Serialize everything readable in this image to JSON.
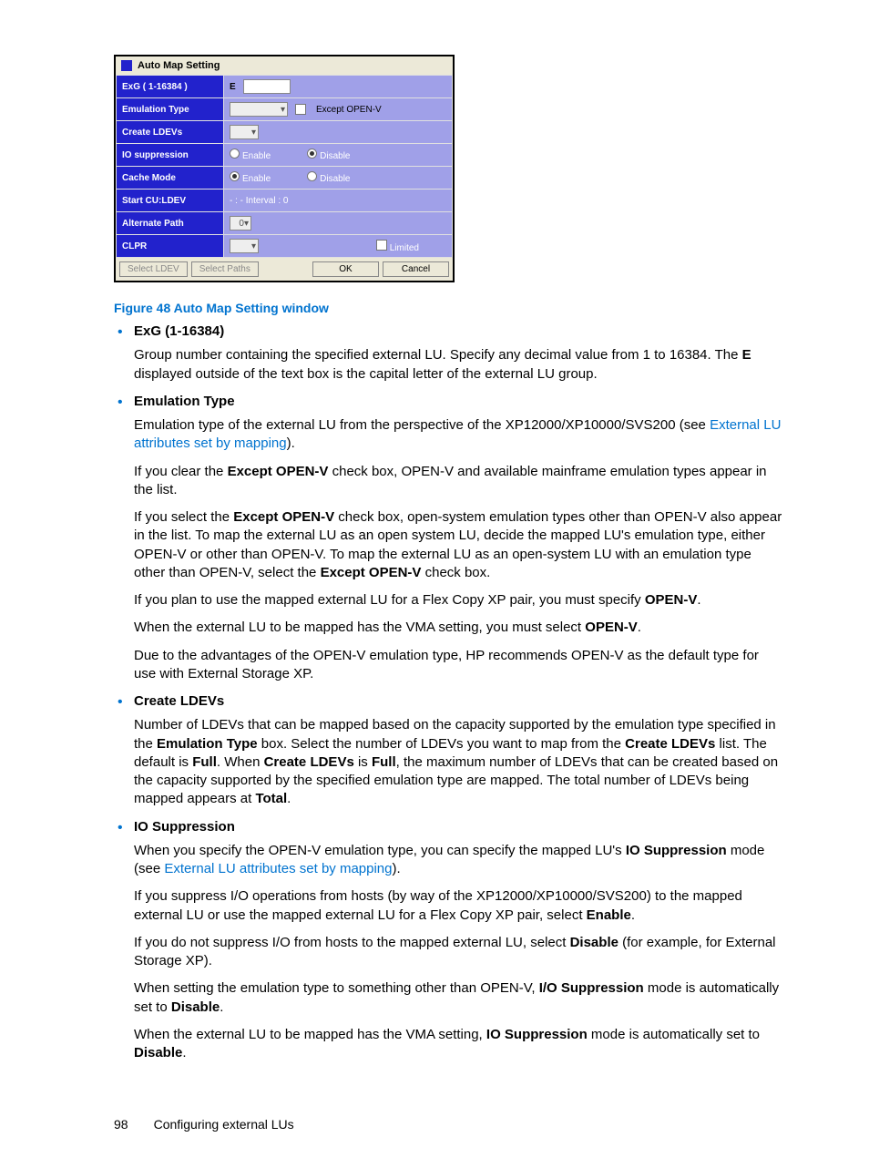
{
  "dialog": {
    "title": "Auto Map Setting",
    "rows": {
      "exg": {
        "label": "ExG ( 1-16384 )",
        "prefix": "E"
      },
      "emul": {
        "label": "Emulation Type",
        "checkbox": "Except OPEN-V"
      },
      "create": {
        "label": "Create LDEVs"
      },
      "io": {
        "label": "IO suppression",
        "opt1": "Enable",
        "opt2": "Disable"
      },
      "cache": {
        "label": "Cache Mode",
        "opt1": "Enable",
        "opt2": "Disable"
      },
      "start": {
        "label": "Start CU:LDEV",
        "text": "- : -     Interval : 0"
      },
      "alt": {
        "label": "Alternate Path",
        "val": "0"
      },
      "clpr": {
        "label": "CLPR",
        "checkbox": "Limited"
      }
    },
    "buttons": {
      "selLdev": "Select LDEV",
      "selPaths": "Select Paths",
      "ok": "OK",
      "cancel": "Cancel"
    }
  },
  "figure_caption": "Figure 48 Auto Map Setting window",
  "items": {
    "exg": {
      "term": "ExG (1-16384)",
      "p1a": "Group number containing the specified external LU. Specify any decimal value from 1 to 16384. The ",
      "p1b": "E",
      "p1c": " displayed outside of the text box is the capital letter of the external LU group."
    },
    "emul": {
      "term": "Emulation Type",
      "p1a": "Emulation type of the external LU from the perspective of the XP12000/XP10000/SVS200 (see ",
      "p1link": "External LU attributes set by mapping",
      "p1c": ").",
      "p2a": "If you clear the ",
      "p2b": "Except OPEN-V",
      "p2c": " check box, OPEN-V and available mainframe emulation types appear in the list.",
      "p3a": "If you select the ",
      "p3b": "Except OPEN-V",
      "p3c": " check box, open-system emulation types other than OPEN-V also appear in the list. To map the external LU as an open system LU, decide the mapped LU's emulation type, either OPEN-V or other than OPEN-V. To map the external LU as an open-system LU with an emulation type other than OPEN-V, select the ",
      "p3d": "Except OPEN-V",
      "p3e": " check box.",
      "p4a": "If you plan to use the mapped external LU for a Flex Copy XP pair, you must specify ",
      "p4b": "OPEN-V",
      "p4c": ".",
      "p5a": "When the external LU to be mapped has the VMA setting, you must select ",
      "p5b": "OPEN-V",
      "p5c": ".",
      "p6": "Due to the advantages of the OPEN-V emulation type, HP recommends OPEN-V as the default type for use with External Storage XP."
    },
    "create": {
      "term": "Create LDEVs",
      "p1a": "Number of LDEVs that can be mapped based on the capacity supported by the emulation type specified in the ",
      "p1b": "Emulation Type",
      "p1c": " box. Select the number of LDEVs you want to map from the ",
      "p1d": "Create LDEVs",
      "p1e": " list. The default is ",
      "p1f": "Full",
      "p1g": ". When ",
      "p1h": "Create LDEVs",
      "p1i": " is ",
      "p1j": "Full",
      "p1k": ", the maximum number of LDEVs that can be created based on the capacity supported by the specified emulation type are mapped. The total number of LDEVs being mapped appears at ",
      "p1l": "Total",
      "p1m": "."
    },
    "io": {
      "term": "IO Suppression",
      "p1a": "When you specify the OPEN-V emulation type, you can specify the mapped LU's ",
      "p1b": "IO Suppression",
      "p1c": " mode (see ",
      "p1link": "External LU attributes set by mapping",
      "p1e": ").",
      "p2a": "If you suppress I/O operations from hosts (by way of the XP12000/XP10000/SVS200) to the mapped external LU or use the mapped external LU for a Flex Copy XP pair, select ",
      "p2b": "Enable",
      "p2c": ".",
      "p3a": "If you do not suppress I/O from hosts to the mapped external LU, select ",
      "p3b": "Disable",
      "p3c": " (for example, for External Storage XP).",
      "p4a": "When setting the emulation type to something other than OPEN-V, ",
      "p4b": "I/O Suppression",
      "p4c": " mode is automatically set to ",
      "p4d": "Disable",
      "p4e": ".",
      "p5a": "When the external LU to be mapped has the VMA setting, ",
      "p5b": "IO Suppression",
      "p5c": " mode is automatically set to ",
      "p5d": "Disable",
      "p5e": "."
    }
  },
  "footer": {
    "pagenum": "98",
    "chapter": "Configuring external LUs"
  }
}
